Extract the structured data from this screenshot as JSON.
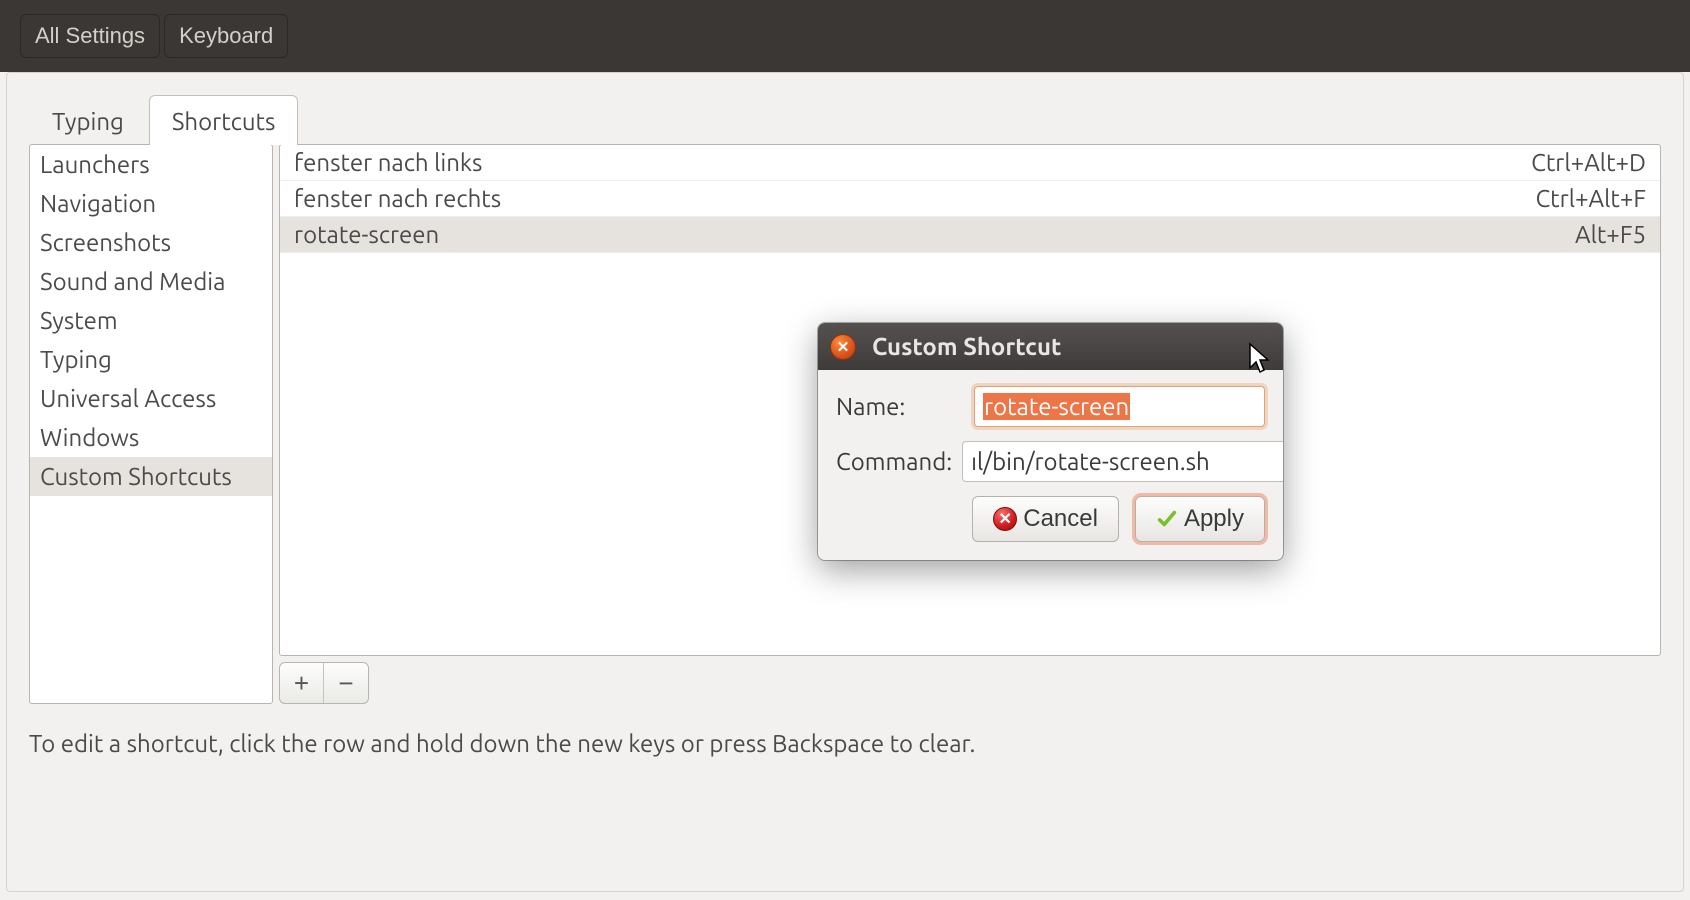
{
  "header": {
    "all_settings": "All Settings",
    "keyboard": "Keyboard"
  },
  "tabs": {
    "typing": "Typing",
    "shortcuts": "Shortcuts",
    "active": "shortcuts"
  },
  "sidebar": {
    "items": [
      {
        "label": "Launchers"
      },
      {
        "label": "Navigation"
      },
      {
        "label": "Screenshots"
      },
      {
        "label": "Sound and Media"
      },
      {
        "label": "System"
      },
      {
        "label": "Typing"
      },
      {
        "label": "Universal Access"
      },
      {
        "label": "Windows"
      },
      {
        "label": "Custom Shortcuts"
      }
    ],
    "selected_index": 8
  },
  "shortcuts": [
    {
      "name": "fenster nach links",
      "accel": "Ctrl+Alt+D"
    },
    {
      "name": "fenster nach rechts",
      "accel": "Ctrl+Alt+F"
    },
    {
      "name": "rotate-screen",
      "accel": "Alt+F5"
    }
  ],
  "shortcuts_selected_index": 2,
  "buttons": {
    "add_glyph": "+",
    "remove_glyph": "−"
  },
  "hint": "To edit a shortcut, click the row and hold down the new keys or press Backspace to clear.",
  "dialog": {
    "title": "Custom Shortcut",
    "name_label": "Name:",
    "command_label": "Command:",
    "name_value": "rotate-screen",
    "command_value": "ıl/bin/rotate-screen.sh",
    "cancel": "Cancel",
    "apply": "Apply"
  }
}
